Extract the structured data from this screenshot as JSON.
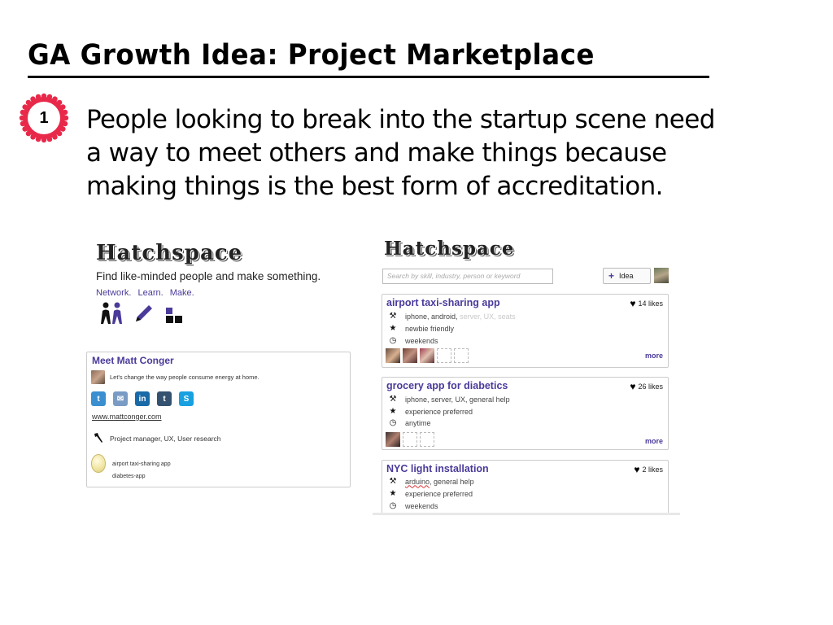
{
  "slide": {
    "title": "GA Growth Idea: Project Marketplace",
    "badge_number": "1",
    "lead_text": "People looking to break into the startup scene need a way to meet others and make things because making things is the best form of accreditation."
  },
  "left_mock": {
    "logo": "Hatchspace",
    "tagline": "Find like-minded people and make something.",
    "nav": [
      "Network.",
      "Learn.",
      "Make."
    ],
    "icons": [
      "people-icon",
      "pencil-icon",
      "blocks-icon"
    ],
    "profile": {
      "heading": "Meet Matt Conger",
      "quote": "Let's change the way people consume energy at home.",
      "social": [
        {
          "name": "twitter-icon",
          "glyph": "t",
          "color": "#3a8fd0"
        },
        {
          "name": "email-icon",
          "glyph": "✉",
          "color": "#7a9bc4"
        },
        {
          "name": "linkedin-icon",
          "glyph": "in",
          "color": "#1a6aa8"
        },
        {
          "name": "tumblr-icon",
          "glyph": "t",
          "color": "#34526f"
        },
        {
          "name": "skype-icon",
          "glyph": "S",
          "color": "#18a0e0"
        }
      ],
      "url": "www.mattconger.com",
      "roles": "Project manager, UX, User research",
      "projects": [
        "airport taxi-sharing app",
        "diabetes-app"
      ]
    }
  },
  "right_mock": {
    "logo": "Hatchspace",
    "search_placeholder": "Search by skill, industry, person or keyword",
    "idea_button": "Idea",
    "projects": [
      {
        "title": "airport taxi-sharing app",
        "likes": "14 likes",
        "skills": "iphone, android,",
        "skills_faded": "server, UX, seats",
        "experience": "newbie friendly",
        "time": "weekends",
        "more": "more"
      },
      {
        "title": "grocery app for diabetics",
        "likes": "26 likes",
        "skills": "iphone, server, UX, general help",
        "experience": "experience preferred",
        "time": "anytime",
        "more": "more"
      },
      {
        "title": "NYC light installation",
        "likes": "2 likes",
        "skills_a": "arduino",
        "skills_b": ", general help",
        "experience": "experience preferred",
        "time": "weekends"
      }
    ]
  }
}
